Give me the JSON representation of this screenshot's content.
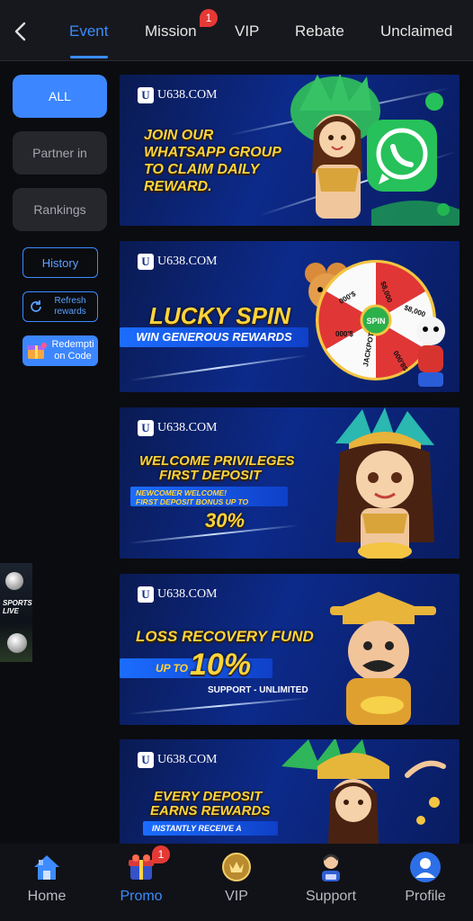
{
  "tabs": [
    {
      "label": "Event",
      "active": true
    },
    {
      "label": "Mission",
      "badge": "1"
    },
    {
      "label": "VIP"
    },
    {
      "label": "Rebate"
    },
    {
      "label": "Unclaimed"
    }
  ],
  "filters": [
    {
      "label": "ALL",
      "active": true
    },
    {
      "label": "Partner in"
    },
    {
      "label": "Rankings"
    }
  ],
  "actions": {
    "history": "History",
    "refresh": "Refresh rewards",
    "redeem": "Redempti on Code"
  },
  "banners": [
    {
      "logo": "U638.COM",
      "headline_lines": [
        "JOIN OUR",
        "WHATSAPP GROUP",
        "TO CLAIM DAILY",
        "REWARD."
      ]
    },
    {
      "logo": "U638.COM",
      "headline": "LUCKY SPIN",
      "pill": "WIN GENEROUS REWARDS",
      "wheel_labels": [
        "$8,000",
        "$8,000",
        "000'$",
        "000'$",
        "000'8$",
        "JACKPOT"
      ],
      "wheel_center": "SPIN"
    },
    {
      "logo": "U638.COM",
      "headline_lines": [
        "WELCOME PRIVILEGES",
        "FIRST DEPOSIT"
      ],
      "pill_lines": [
        "NEWCOMER WELCOME!",
        "FIRST DEPOSIT BONUS UP TO"
      ],
      "value": "30%"
    },
    {
      "logo": "U638.COM",
      "headline": "LOSS RECOVERY FUND",
      "pill_prefix": "UP TO",
      "value": "10%",
      "sub": "SUPPORT - UNLIMITED"
    },
    {
      "logo": "U638.COM",
      "headline_lines": [
        "EVERY DEPOSIT",
        "EARNS REWARDS"
      ],
      "pill": "INSTANTLY RECEIVE A"
    }
  ],
  "sports_widget": {
    "line1": "SPORTS",
    "line2": "LIVE"
  },
  "bottom_nav": [
    {
      "label": "Home",
      "icon": "home-icon"
    },
    {
      "label": "Promo",
      "icon": "promo-icon",
      "active": true,
      "badge": "1"
    },
    {
      "label": "VIP",
      "icon": "vip-icon"
    },
    {
      "label": "Support",
      "icon": "support-icon"
    },
    {
      "label": "Profile",
      "icon": "profile-icon"
    }
  ],
  "colors": {
    "accent": "#3a8cff",
    "background": "#0b0c10",
    "headline_yellow": "#ffd43b",
    "badge_red": "#e53935"
  }
}
